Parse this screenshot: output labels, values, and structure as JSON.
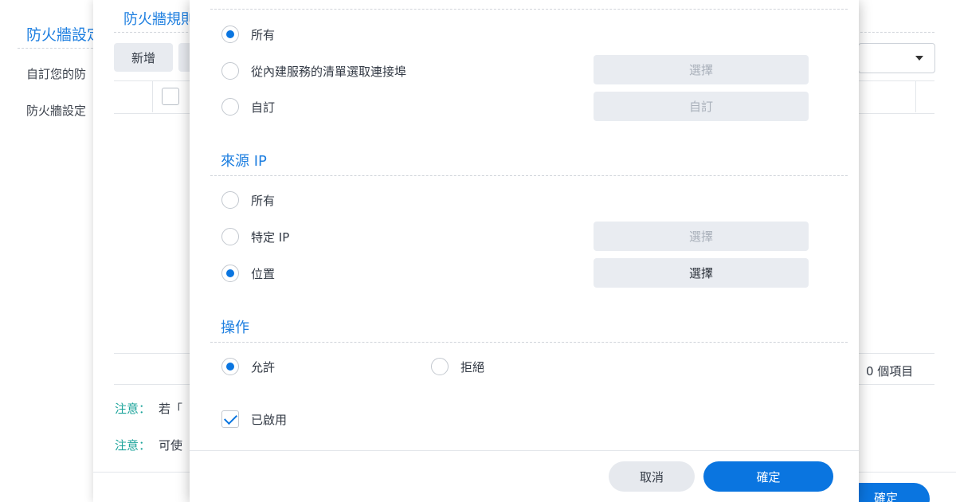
{
  "background_page": {
    "title": "防火牆設定",
    "lines": [
      "自訂您的防",
      "防火牆設定"
    ]
  },
  "rules_window": {
    "title": "防火牆規則",
    "toolbar": {
      "add_label": "新增"
    },
    "footer_count": "0 個項目",
    "notes": [
      {
        "label": "注意：",
        "text": "若「"
      },
      {
        "label": "注意：",
        "text": "可使"
      }
    ],
    "ok_label": "確定"
  },
  "dialog": {
    "ports": {
      "options": [
        {
          "label": "所有",
          "checked": true,
          "button": null
        },
        {
          "label": "從內建服務的清單選取連接埠",
          "checked": false,
          "button": {
            "label": "選擇",
            "enabled": false
          }
        },
        {
          "label": "自訂",
          "checked": false,
          "button": {
            "label": "自訂",
            "enabled": false
          }
        }
      ]
    },
    "source_ip": {
      "title": "來源 IP",
      "options": [
        {
          "label": "所有",
          "checked": false,
          "button": null
        },
        {
          "label": "特定 IP",
          "checked": false,
          "button": {
            "label": "選擇",
            "enabled": false
          }
        },
        {
          "label": "位置",
          "checked": true,
          "button": {
            "label": "選擇",
            "enabled": true
          }
        }
      ]
    },
    "action": {
      "title": "操作",
      "options": [
        {
          "label": "允許",
          "checked": true
        },
        {
          "label": "拒絕",
          "checked": false
        }
      ]
    },
    "enabled": {
      "label": "已啟用",
      "checked": true
    },
    "cancel_label": "取消",
    "ok_label": "確定"
  },
  "colors": {
    "accent": "#0a75e0",
    "title_blue": "#1e7fe0",
    "note_teal": "#1aa39a"
  }
}
